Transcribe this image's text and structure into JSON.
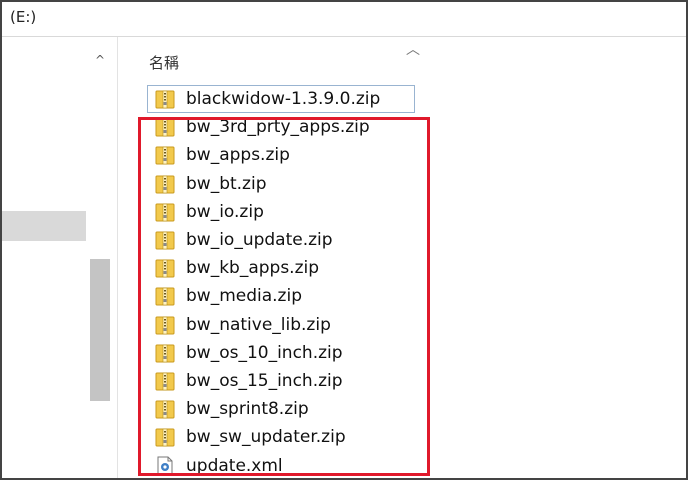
{
  "address": {
    "path": "(E:)"
  },
  "columns": {
    "name_header": "名稱"
  },
  "files": [
    {
      "name": "blackwidow-1.3.9.0.zip",
      "icon": "zip-folder-icon"
    },
    {
      "name": "bw_3rd_prty_apps.zip",
      "icon": "zip-folder-icon"
    },
    {
      "name": "bw_apps.zip",
      "icon": "zip-folder-icon"
    },
    {
      "name": "bw_bt.zip",
      "icon": "zip-folder-icon"
    },
    {
      "name": "bw_io.zip",
      "icon": "zip-folder-icon"
    },
    {
      "name": "bw_io_update.zip",
      "icon": "zip-folder-icon"
    },
    {
      "name": "bw_kb_apps.zip",
      "icon": "zip-folder-icon"
    },
    {
      "name": "bw_media.zip",
      "icon": "zip-folder-icon"
    },
    {
      "name": "bw_native_lib.zip",
      "icon": "zip-folder-icon"
    },
    {
      "name": "bw_os_10_inch.zip",
      "icon": "zip-folder-icon"
    },
    {
      "name": "bw_os_15_inch.zip",
      "icon": "zip-folder-icon"
    },
    {
      "name": "bw_sprint8.zip",
      "icon": "zip-folder-icon"
    },
    {
      "name": "bw_sw_updater.zip",
      "icon": "zip-folder-icon"
    },
    {
      "name": "update.xml",
      "icon": "xml-file-icon"
    }
  ],
  "colors": {
    "annotation": "#e0192b",
    "zip_icon": "#f2c94c",
    "focus_outline": "#99b4d1"
  }
}
